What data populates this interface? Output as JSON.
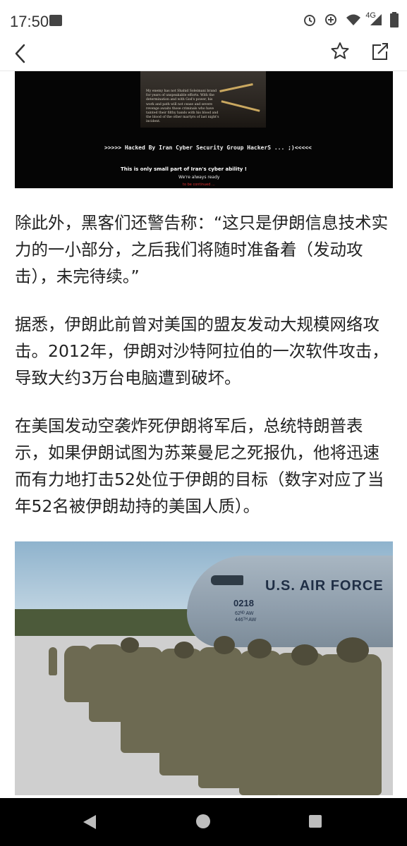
{
  "status_bar": {
    "time": "17:50",
    "network": "4G",
    "icons": [
      "image-icon",
      "alarm-icon",
      "data-saver-icon",
      "wifi-icon",
      "signal-icon",
      "battery-icon"
    ]
  },
  "nav": {
    "icons": [
      "back-icon",
      "star-icon",
      "share-icon"
    ]
  },
  "hack_image": {
    "inner_text": "My enemy has not Shahid Soleimani brand for years of unspeakable efforts. With the determination and with God's power, his work and path will not cease and severe revenge awaits those criminals who have tainted their filthy hands with his blood and the blood of the other martyrs of last night's incident.",
    "signature": ">>>>> Hacked By Iran Cyber Security Group HackerS ... ;)<<<<<",
    "note": "This is only small part of Iran's cyber ability !",
    "ready": "We're always ready",
    "cont": "to be continued ..."
  },
  "article": {
    "paragraphs": [
      "除此外，黑客们还警告称：“这只是伊朗信息技术实力的一小部分，之后我们将随时准备着（发动攻击），未完待续。”",
      "据悉，伊朗此前曾对美国的盟友发动大规模网络攻击。2012年，伊朗对沙特阿拉伯的一次软件攻击，导致大约3万台电脑遭到破坏。",
      "在美国发动空袭炸死伊朗将军后，总统特朗普表示，如果伊朗试图为苏莱曼尼之死报仇，他将迅速而有力地打击52处位于伊朗的目标（数字对应了当年52名被伊朗劫持的美国人质）。"
    ]
  },
  "photo": {
    "plane_text": "U.S. AIR FORCE",
    "tail_number": "0218",
    "tail_sub_1": "62ᴺᴰ AW",
    "tail_sub_2": "446ᵀᴴ AW"
  },
  "system_nav": {
    "icons": [
      "back-triangle-icon",
      "home-circle-icon",
      "recents-square-icon"
    ]
  }
}
